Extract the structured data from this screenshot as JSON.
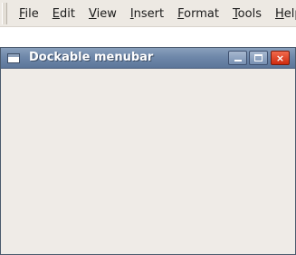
{
  "menubar": {
    "items": [
      {
        "mnemonic": "F",
        "rest": "ile"
      },
      {
        "mnemonic": "E",
        "rest": "dit"
      },
      {
        "mnemonic": "V",
        "rest": "iew"
      },
      {
        "mnemonic": "I",
        "rest": "nsert"
      },
      {
        "mnemonic": "F",
        "rest": "ormat"
      },
      {
        "mnemonic": "T",
        "rest": "ools"
      },
      {
        "mnemonic": "H",
        "rest": "elp"
      }
    ]
  },
  "window": {
    "title": "Dockable menubar",
    "icons": {
      "app": "window-icon",
      "minimize": "minimize-icon",
      "maximize": "maximize-icon",
      "close": "close-icon"
    },
    "close_glyph": "×",
    "colors": {
      "titlebar": "#6f88aa",
      "close_button": "#cf2b10",
      "background": "#efebe7"
    }
  }
}
